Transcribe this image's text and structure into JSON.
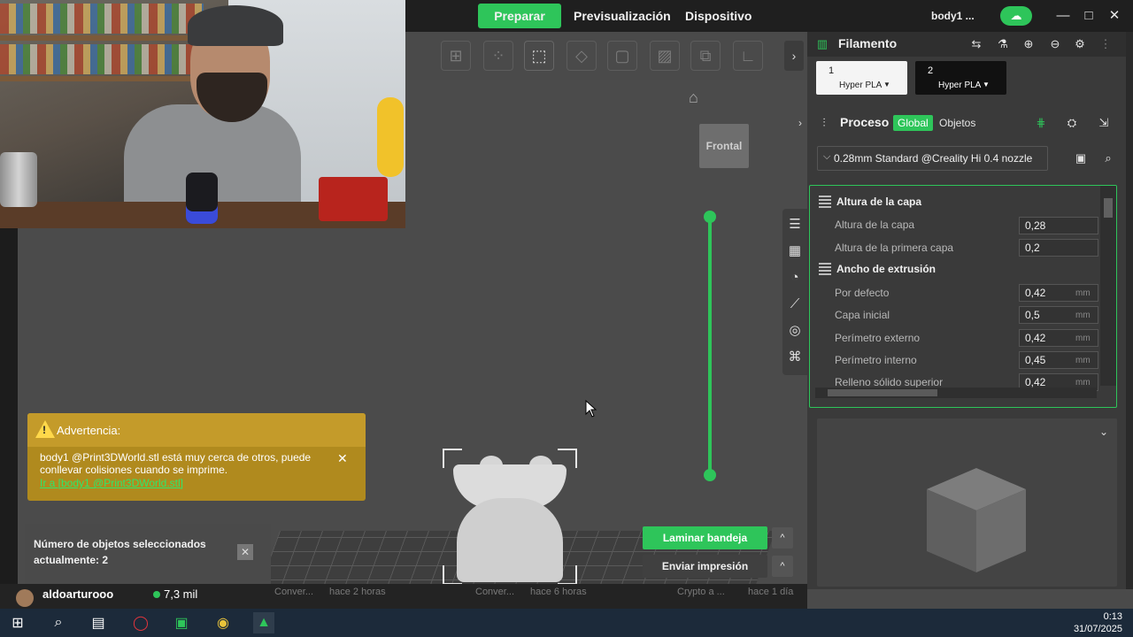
{
  "topbar": {
    "tabs": [
      "Preparar",
      "Previsualización",
      "Dispositivo"
    ],
    "project_title": "body1 ...",
    "window_controls": [
      "minimize",
      "maximize",
      "close"
    ]
  },
  "toolbar": {
    "tools": [
      "add-icon",
      "arrange-icon",
      "auto-orient-icon",
      "lay-on-face-icon",
      "cut-icon",
      "hollow-icon",
      "support-paint-icon",
      "assemble-icon",
      "measure-icon"
    ]
  },
  "viewport": {
    "view_cube_label": "Frontal",
    "side_tools": [
      "layers-icon",
      "variable-height-icon",
      "speed-icon",
      "support-icon",
      "seam-icon",
      "modifier-icon"
    ]
  },
  "warning": {
    "title": "Advertencia:",
    "message": "body1 @Print3DWorld.stl está muy cerca de otros, puede conllevar colisiones cuando se imprime.",
    "link": "Ir a [body1 @Print3DWorld.stl]"
  },
  "selection": {
    "text": "Número de objetos seleccionados actualmente: 2"
  },
  "actions": {
    "slice": "Laminar bandeja",
    "print": "Enviar impresión"
  },
  "chat": {
    "user": "aldoarturooo",
    "views": "7,3 mil",
    "ghost_items": [
      "Conver...",
      "hace 2 horas",
      "Conver...",
      "hace 6 horas",
      "Crypto a ...",
      "hace 1 día"
    ]
  },
  "filament": {
    "title": "Filamento",
    "slots": [
      {
        "num": "1",
        "name": "Hyper PLA"
      },
      {
        "num": "2",
        "name": "Hyper PLA"
      }
    ]
  },
  "process": {
    "title": "Proceso",
    "global_label": "Global",
    "objects_label": "Objetos",
    "preset": "0.28mm Standard @Creality Hi 0.4 nozzle",
    "sections": [
      {
        "title": "Altura de la capa",
        "params": [
          {
            "label": "Altura de la capa",
            "value": "0,28",
            "unit": ""
          },
          {
            "label": "Altura de la primera capa",
            "value": "0,2",
            "unit": ""
          }
        ]
      },
      {
        "title": "Ancho de extrusión",
        "params": [
          {
            "label": "Por defecto",
            "value": "0,42",
            "unit": "mm"
          },
          {
            "label": "Capa inicial",
            "value": "0,5",
            "unit": "mm"
          },
          {
            "label": "Perímetro externo",
            "value": "0,42",
            "unit": "mm"
          },
          {
            "label": "Perímetro interno",
            "value": "0,45",
            "unit": "mm"
          },
          {
            "label": "Relleno sólido superior",
            "value": "0,42",
            "unit": "mm"
          }
        ]
      }
    ]
  },
  "taskbar": {
    "time": "0:13",
    "date": "31/07/2025"
  },
  "colors": {
    "accent": "#2ec55a",
    "warning": "#b08a1e",
    "panel": "#3a3a3a"
  }
}
